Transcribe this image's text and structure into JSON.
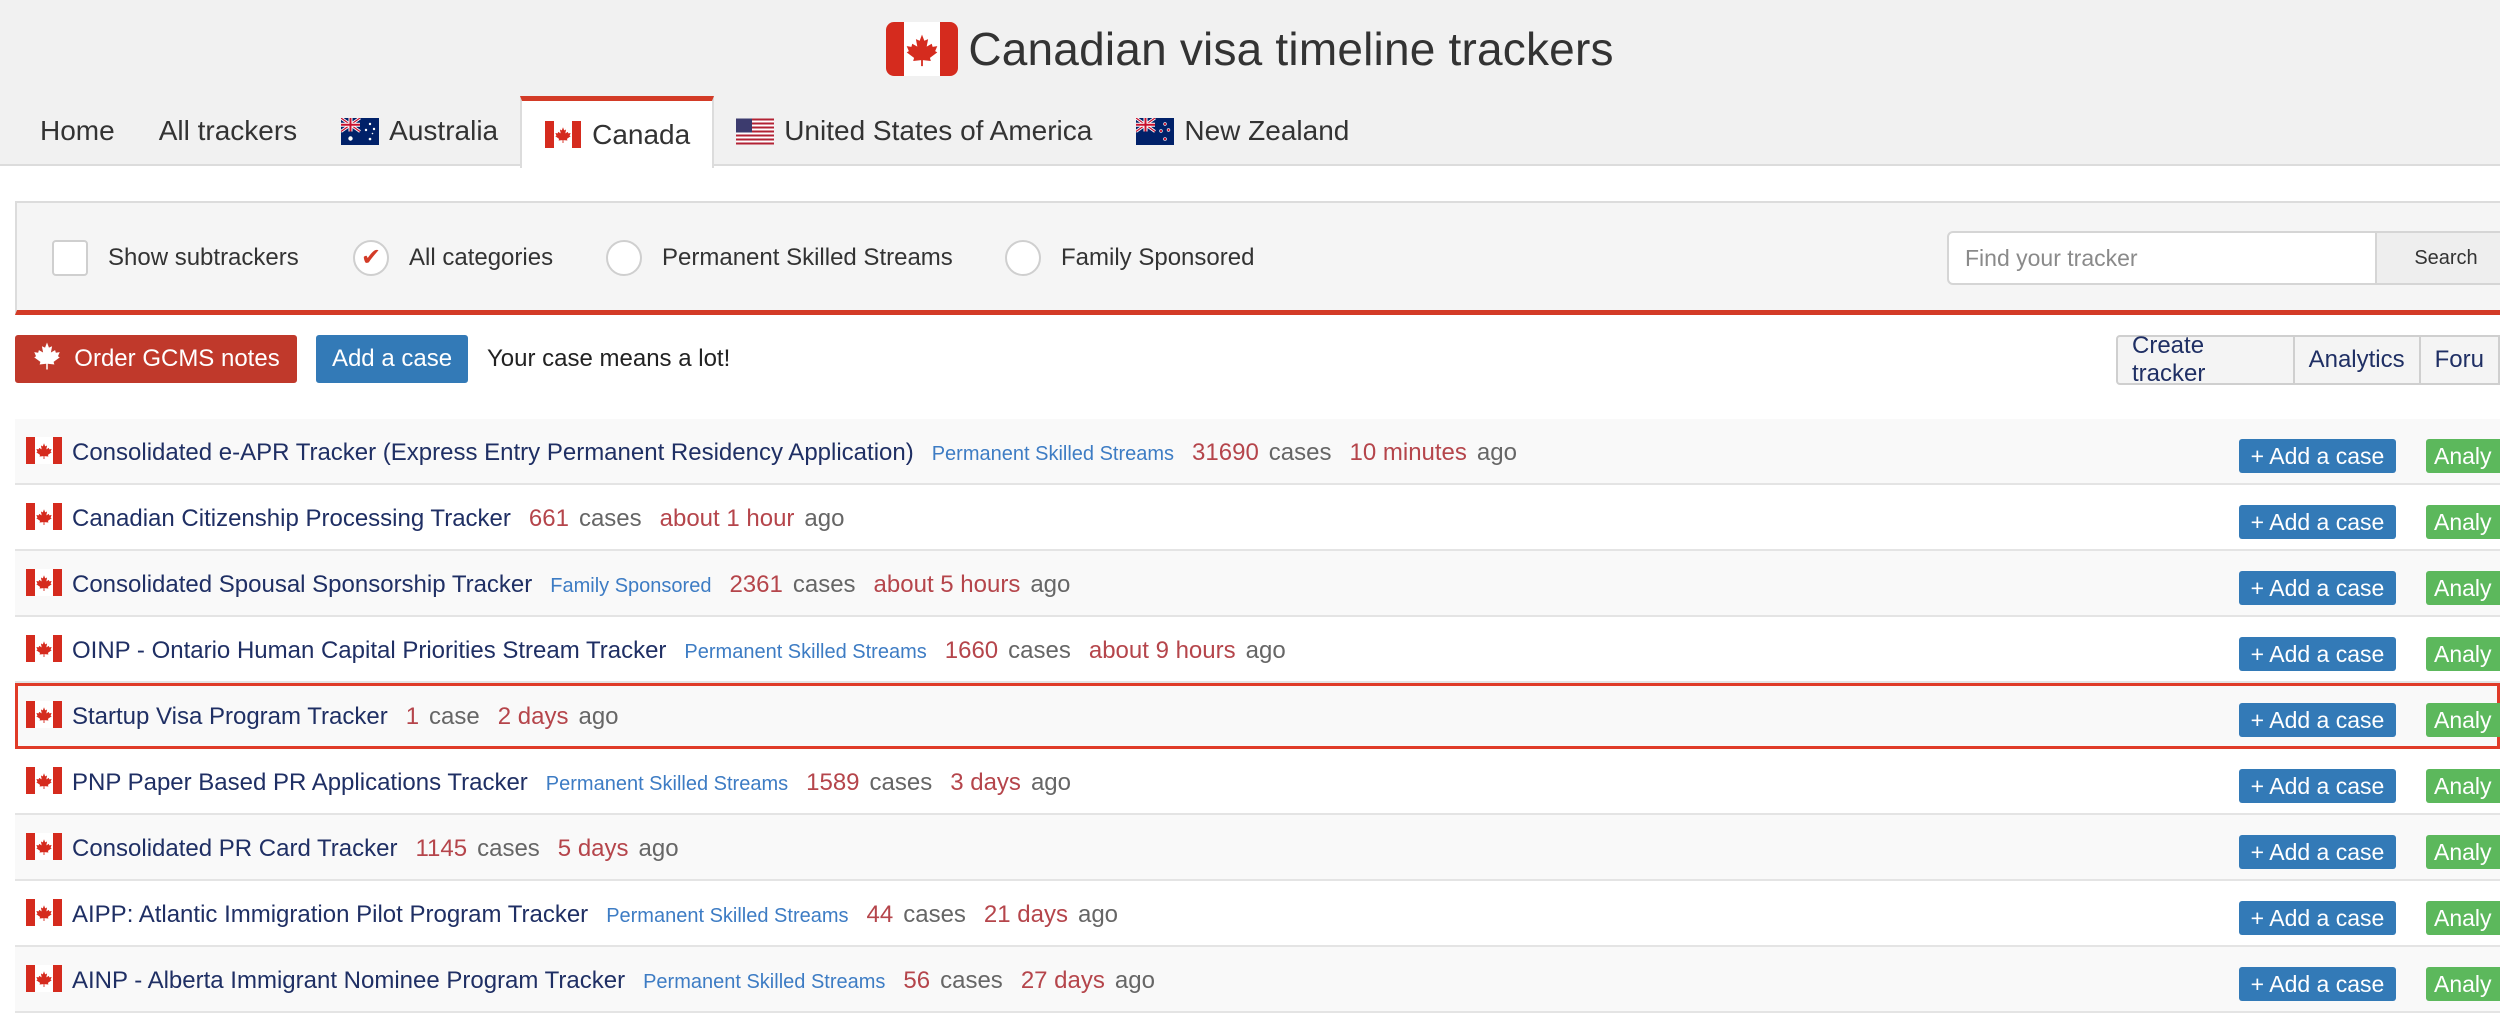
{
  "header": {
    "title": "Canadian visa timeline trackers",
    "title_flag_icon": "canada-flag-icon"
  },
  "tabs": [
    {
      "label": "Home",
      "flag": null,
      "active": false
    },
    {
      "label": "All trackers",
      "flag": null,
      "active": false
    },
    {
      "label": "Australia",
      "flag": "australia-flag-icon",
      "active": false
    },
    {
      "label": "Canada",
      "flag": "canada-flag-icon",
      "active": true
    },
    {
      "label": "United States of America",
      "flag": "usa-flag-icon",
      "active": false
    },
    {
      "label": "New Zealand",
      "flag": "new-zealand-flag-icon",
      "active": false
    }
  ],
  "filters": {
    "show_subtrackers": {
      "label": "Show subtrackers",
      "checked": false
    },
    "all_categories": {
      "label": "All categories",
      "selected": true
    },
    "permanent_skilled": {
      "label": "Permanent Skilled Streams",
      "selected": false
    },
    "family_sponsored": {
      "label": "Family Sponsored",
      "selected": false
    },
    "search": {
      "placeholder": "Find your tracker",
      "value": "",
      "button_label": "Search"
    }
  },
  "actions": {
    "order_label": "Order GCMS notes",
    "order_icon": "maple-leaf-icon",
    "add_case_label": "Add a case",
    "tagline": "Your case means a lot!",
    "create_tracker_label": "Create tracker",
    "analytics_label": "Analytics",
    "forum_label": "Foru"
  },
  "row_buttons": {
    "add_case_label": "+ Add a case",
    "analytics_label": "Analy"
  },
  "trackers": [
    {
      "name": "Consolidated e-APR Tracker (Express Entry Permanent Residency Application)",
      "category": "Permanent Skilled Streams",
      "count": "31690",
      "count_word": "cases",
      "time": "10 minutes",
      "ago": "ago",
      "highlighted": false
    },
    {
      "name": "Canadian Citizenship Processing Tracker",
      "category": "",
      "count": "661",
      "count_word": "cases",
      "time": "about 1 hour",
      "ago": "ago",
      "highlighted": false
    },
    {
      "name": "Consolidated Spousal Sponsorship Tracker",
      "category": "Family Sponsored",
      "count": "2361",
      "count_word": "cases",
      "time": "about 5 hours",
      "ago": "ago",
      "highlighted": false
    },
    {
      "name": "OINP - Ontario Human Capital Priorities Stream Tracker",
      "category": "Permanent Skilled Streams",
      "count": "1660",
      "count_word": "cases",
      "time": "about 9 hours",
      "ago": "ago",
      "highlighted": false
    },
    {
      "name": "Startup Visa Program Tracker",
      "category": "",
      "count": "1",
      "count_word": "case",
      "time": "2 days",
      "ago": "ago",
      "highlighted": true
    },
    {
      "name": "PNP Paper Based PR Applications Tracker",
      "category": "Permanent Skilled Streams",
      "count": "1589",
      "count_word": "cases",
      "time": "3 days",
      "ago": "ago",
      "highlighted": false
    },
    {
      "name": "Consolidated PR Card Tracker",
      "category": "",
      "count": "1145",
      "count_word": "cases",
      "time": "5 days",
      "ago": "ago",
      "highlighted": false
    },
    {
      "name": "AIPP: Atlantic Immigration Pilot Program Tracker",
      "category": "Permanent Skilled Streams",
      "count": "44",
      "count_word": "cases",
      "time": "21 days",
      "ago": "ago",
      "highlighted": false
    },
    {
      "name": "AINP - Alberta Immigrant Nominee Program Tracker",
      "category": "Permanent Skilled Streams",
      "count": "56",
      "count_word": "cases",
      "time": "27 days",
      "ago": "ago",
      "highlighted": false
    }
  ],
  "colors": {
    "accent_red": "#d33b27",
    "primary_blue": "#337ab7",
    "analytics_green": "#5cb85c",
    "link_navy": "#1f2f64",
    "count_red": "#b5454b",
    "category_blue": "#3d7cc4"
  }
}
